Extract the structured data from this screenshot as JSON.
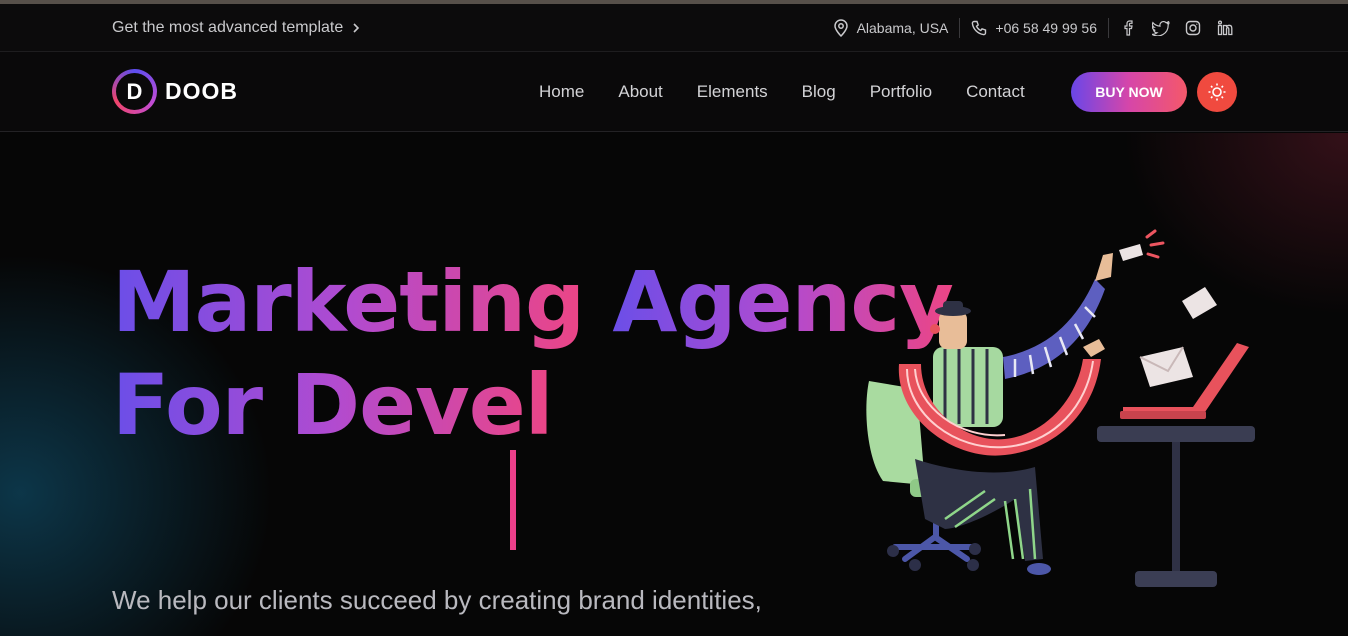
{
  "topbar": {
    "promo_text": "Get the most advanced template",
    "location": "Alabama, USA",
    "phone": "+06 58 49 99 56",
    "social_icons": [
      "facebook-icon",
      "twitter-icon",
      "instagram-icon",
      "linkedin-icon"
    ]
  },
  "brand": {
    "logo_letter": "D",
    "name": "DOOB"
  },
  "nav": {
    "items": [
      "Home",
      "About",
      "Elements",
      "Blog",
      "Portfolio",
      "Contact"
    ],
    "buy_label": "BUY NOW"
  },
  "hero": {
    "title_lines": [
      "Marketing",
      "Agency",
      "For Devel"
    ],
    "description": "We help our clients succeed by creating brand identities,"
  },
  "colors": {
    "accent_gradient": [
      "#6a46e8",
      "#d646a9",
      "#f4586a"
    ],
    "theme_toggle": "#f04a3f",
    "background": "#060606"
  }
}
